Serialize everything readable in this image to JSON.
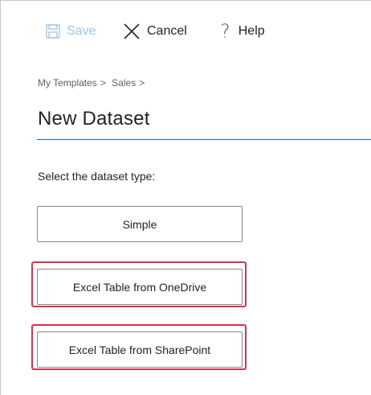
{
  "toolbar": {
    "save_label": "Save",
    "cancel_label": "Cancel",
    "help_label": "Help",
    "icons": {
      "save": "floppy-disk-icon",
      "cancel": "close-x-icon",
      "help": "question-mark-icon"
    },
    "save_color": "#9cc3ea"
  },
  "breadcrumb": {
    "items": [
      "My Templates",
      "Sales"
    ],
    "separator": ">"
  },
  "page": {
    "title": "New Dataset",
    "prompt": "Select the dataset type:"
  },
  "options": [
    {
      "label": "Simple",
      "highlighted": false
    },
    {
      "label": "Excel Table from OneDrive",
      "highlighted": true
    },
    {
      "label": "Excel Table from SharePoint",
      "highlighted": true
    }
  ],
  "colors": {
    "accent": "#0f6cbd",
    "highlight": "#d1344f"
  },
  "help_glyph": "?"
}
